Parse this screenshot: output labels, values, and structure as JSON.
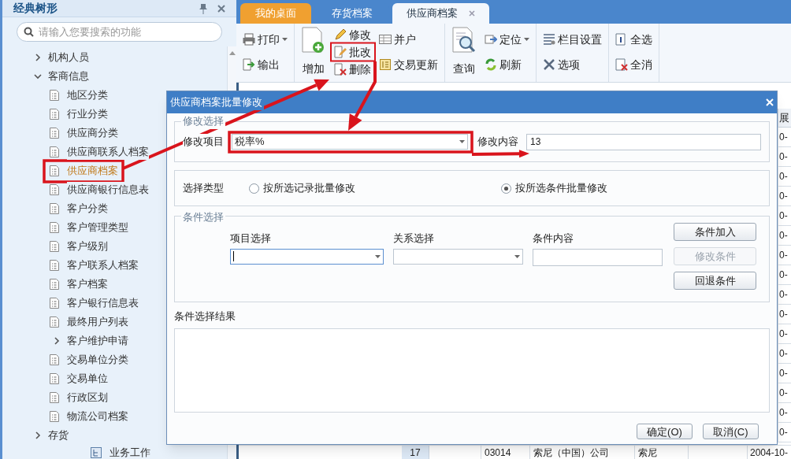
{
  "sidebar": {
    "title": "经典树形",
    "search": {
      "placeholder": "请输入您要搜索的功能"
    },
    "tree": [
      {
        "kind": "folder",
        "label": "机构人员",
        "expanded": false,
        "selected": false
      },
      {
        "kind": "folder",
        "label": "客商信息",
        "expanded": true,
        "selected": false,
        "children": [
          {
            "kind": "leaf",
            "label": "地区分类",
            "selected": false
          },
          {
            "kind": "leaf",
            "label": "行业分类",
            "selected": false
          },
          {
            "kind": "leaf",
            "label": "供应商分类",
            "selected": false
          },
          {
            "kind": "leaf",
            "label": "供应商联系人档案",
            "selected": false
          },
          {
            "kind": "leaf",
            "label": "供应商档案",
            "selected": true
          },
          {
            "kind": "leaf",
            "label": "供应商银行信息表",
            "selected": false
          },
          {
            "kind": "leaf",
            "label": "客户分类",
            "selected": false
          },
          {
            "kind": "leaf",
            "label": "客户管理类型",
            "selected": false
          },
          {
            "kind": "leaf",
            "label": "客户级别",
            "selected": false
          },
          {
            "kind": "leaf",
            "label": "客户联系人档案",
            "selected": false
          },
          {
            "kind": "leaf",
            "label": "客户档案",
            "selected": false
          },
          {
            "kind": "leaf",
            "label": "客户银行信息表",
            "selected": false
          },
          {
            "kind": "leaf",
            "label": "最终用户列表",
            "selected": false
          },
          {
            "kind": "folder",
            "label": "客户维护申请",
            "expanded": false,
            "selected": false
          },
          {
            "kind": "leaf",
            "label": "交易单位分类",
            "selected": false
          },
          {
            "kind": "leaf",
            "label": "交易单位",
            "selected": false
          },
          {
            "kind": "leaf",
            "label": "行政区划",
            "selected": false
          },
          {
            "kind": "leaf",
            "label": "物流公司档案",
            "selected": false
          }
        ]
      },
      {
        "kind": "folder",
        "label": "存货",
        "expanded": false,
        "selected": false
      }
    ],
    "bottom_item": {
      "label": "业务工作"
    }
  },
  "tabs": [
    {
      "label": "我的桌面",
      "kind": "home",
      "selected": false,
      "closable": false
    },
    {
      "label": "存货档案",
      "kind": "page",
      "selected": false,
      "closable": false
    },
    {
      "label": "供应商档案",
      "kind": "page",
      "selected": true,
      "closable": true
    }
  ],
  "toolbar": {
    "groups": [
      {
        "columns": [
          [
            {
              "label": "打印",
              "kind": "small",
              "dropdown": true
            },
            {
              "label": "输出",
              "kind": "small",
              "dropdown": false
            }
          ]
        ]
      },
      {
        "columns": [
          [
            {
              "label": "增加",
              "kind": "large",
              "dropdown": false
            }
          ],
          [
            {
              "label": "修改",
              "kind": "small",
              "dropdown": false
            },
            {
              "label": "批改",
              "kind": "small",
              "dropdown": false
            },
            {
              "label": "删除",
              "kind": "small",
              "dropdown": false
            }
          ],
          [
            {
              "label": "并户",
              "kind": "small",
              "dropdown": false
            },
            {
              "label": "交易更新",
              "kind": "small",
              "dropdown": false
            }
          ]
        ]
      },
      {
        "columns": [
          [
            {
              "label": "查询",
              "kind": "large",
              "dropdown": false
            }
          ],
          [
            {
              "label": "定位",
              "kind": "small",
              "dropdown": true
            },
            {
              "label": "刷新",
              "kind": "small",
              "dropdown": false
            }
          ]
        ]
      },
      {
        "columns": [
          [
            {
              "label": "栏目设置",
              "kind": "small",
              "dropdown": false
            },
            {
              "label": "选项",
              "kind": "small",
              "dropdown": false
            }
          ]
        ]
      },
      {
        "columns": [
          [
            {
              "label": "全选",
              "kind": "small",
              "dropdown": false
            },
            {
              "label": "全消",
              "kind": "small",
              "dropdown": false
            }
          ]
        ]
      }
    ]
  },
  "table": {
    "column_header": "展",
    "column_cells": [
      "0-",
      "0-",
      "0-",
      "0-",
      "0-",
      "0-",
      "0-",
      "0-",
      "0-",
      "0-",
      "0-",
      "0-",
      "0-",
      "0-",
      "0-",
      "0-"
    ],
    "row": {
      "row_number": "17",
      "code": "03014",
      "name": "索尼（中国）公司",
      "short_name": "索尼",
      "date": "2004-10-"
    }
  },
  "dialog": {
    "title": "供应商档案批量修改",
    "modify": {
      "legend": "修改选择",
      "item_label": "修改项目",
      "item_value": "税率%",
      "content_label": "修改内容",
      "content_value": "13"
    },
    "select_type": {
      "label": "选择类型",
      "options": [
        {
          "label": "按所选记录批量修改",
          "selected": false
        },
        {
          "label": "按所选条件批量修改",
          "selected": true
        }
      ]
    },
    "conditions": {
      "legend": "条件选择",
      "fields": [
        {
          "kind": "dropdown",
          "label": "项目选择",
          "focused": true
        },
        {
          "kind": "dropdown",
          "label": "关系选择",
          "focused": false
        },
        {
          "kind": "text",
          "label": "条件内容",
          "focused": false
        }
      ],
      "buttons": [
        {
          "label": "条件加入",
          "disabled": false
        },
        {
          "label": "修改条件",
          "disabled": true
        },
        {
          "label": "回退条件",
          "disabled": false
        }
      ]
    },
    "results_label": "条件选择结果",
    "buttons": [
      {
        "label": "确定(O)"
      },
      {
        "label": "取消(C)"
      }
    ]
  }
}
